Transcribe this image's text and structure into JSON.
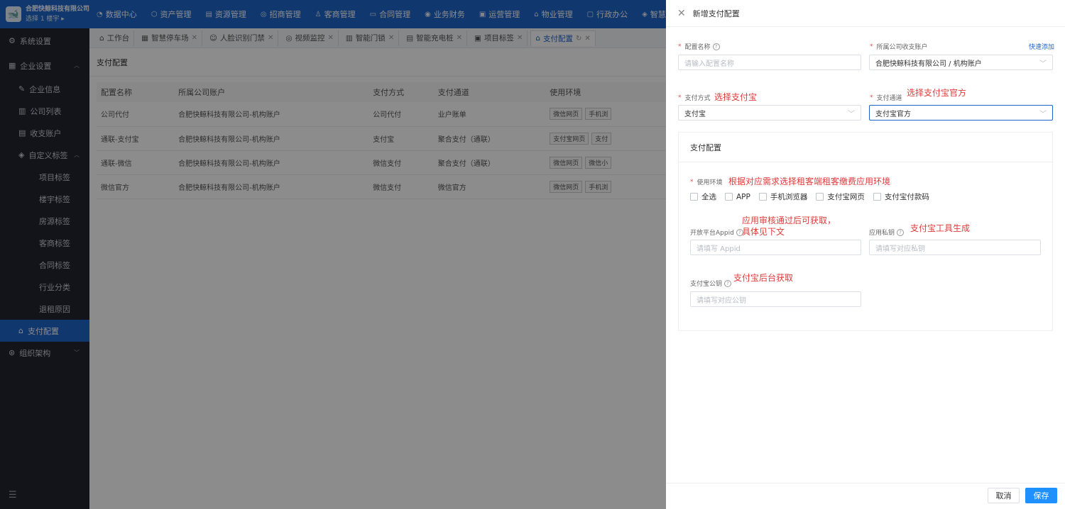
{
  "header": {
    "company": "合肥快鲸科技有限公司",
    "building": "选择 1 楼宇 ▸",
    "nav": [
      {
        "label": "数据中心",
        "icon": "dashboard-icon"
      },
      {
        "label": "资产管理",
        "icon": "asset-icon"
      },
      {
        "label": "资源管理",
        "icon": "resource-icon"
      },
      {
        "label": "招商管理",
        "icon": "investment-icon"
      },
      {
        "label": "客商管理",
        "icon": "customer-icon"
      },
      {
        "label": "合同管理",
        "icon": "contract-icon"
      },
      {
        "label": "业务财务",
        "icon": "finance-icon"
      },
      {
        "label": "运营管理",
        "icon": "operation-icon"
      },
      {
        "label": "物业管理",
        "icon": "property-icon"
      },
      {
        "label": "行政办公",
        "icon": "office-icon"
      },
      {
        "label": "智慧物联",
        "icon": "iot-icon"
      }
    ]
  },
  "sidebar": {
    "system": "系统设置",
    "enterprise": "企业设置",
    "items": [
      "企业信息",
      "公司列表",
      "收支账户"
    ],
    "custom_tags": "自定义标签",
    "tags": [
      "项目标签",
      "楼宇标签",
      "房源标签",
      "客商标签",
      "合同标签",
      "行业分类",
      "退租原因"
    ],
    "pay_config": "支付配置",
    "org": "组织架构"
  },
  "tabs": [
    {
      "label": "工作台",
      "active": false
    },
    {
      "label": "智慧停车场",
      "active": false
    },
    {
      "label": "人脸识别门禁",
      "active": false
    },
    {
      "label": "视频监控",
      "active": false
    },
    {
      "label": "智能门锁",
      "active": false
    },
    {
      "label": "智能充电桩",
      "active": false
    },
    {
      "label": "项目标签",
      "active": false
    },
    {
      "label": "支付配置",
      "active": true
    }
  ],
  "page_title": "支付配置",
  "table": {
    "columns": [
      "配置名称",
      "所属公司账户",
      "支付方式",
      "支付通道",
      "使用环境"
    ],
    "rows": [
      {
        "name": "公司代付",
        "account": "合肥快鲸科技有限公司-机构账户",
        "method": "公司代付",
        "channel": "业户账单",
        "envs": [
          "微信网页",
          "手机浏"
        ]
      },
      {
        "name": "通联-支付宝",
        "account": "合肥快鲸科技有限公司-机构账户",
        "method": "支付宝",
        "channel": "聚合支付（通联）",
        "envs": [
          "支付宝网页",
          "支付"
        ]
      },
      {
        "name": "通联-微信",
        "account": "合肥快鲸科技有限公司-机构账户",
        "method": "微信支付",
        "channel": "聚合支付（通联）",
        "envs": [
          "微信网页",
          "微信小"
        ]
      },
      {
        "name": "微信官方",
        "account": "合肥快鲸科技有限公司-机构账户",
        "method": "微信支付",
        "channel": "微信官方",
        "envs": [
          "微信网页",
          "手机浏"
        ]
      }
    ]
  },
  "drawer": {
    "title": "新增支付配置",
    "config_name_label": "配置名称",
    "config_name_placeholder": "请输入配置名称",
    "account_label": "所属公司收支账户",
    "quick_add": "快速添加",
    "account_value": "合肥快鲸科技有限公司 / 机构账户",
    "method_label": "支付方式",
    "method_note": "选择支付宝",
    "method_value": "支付宝",
    "channel_label": "支付通道",
    "channel_note": "选择支付宝官方",
    "channel_value": "支付宝官方",
    "card_title": "支付配置",
    "env_label": "使用环境",
    "env_note": "根据对应需求选择租客端租客缴费应用环境",
    "env_options": [
      "全选",
      "APP",
      "手机浏览器",
      "支付宝网页",
      "支付宝付款码"
    ],
    "appid_label": "开放平台Appid",
    "appid_note_1": "应用审核通过后可获取，",
    "appid_note_2": "具体见下文",
    "appid_placeholder": "请填写 Appid",
    "private_key_label": "应用私钥",
    "private_key_note": "支付宝工具生成",
    "private_key_placeholder": "请填写对应私钥",
    "public_key_label": "支付宝公钥",
    "public_key_note": "支付宝后台获取",
    "public_key_placeholder": "请填写对应公钥",
    "cancel": "取消",
    "save": "保存"
  }
}
